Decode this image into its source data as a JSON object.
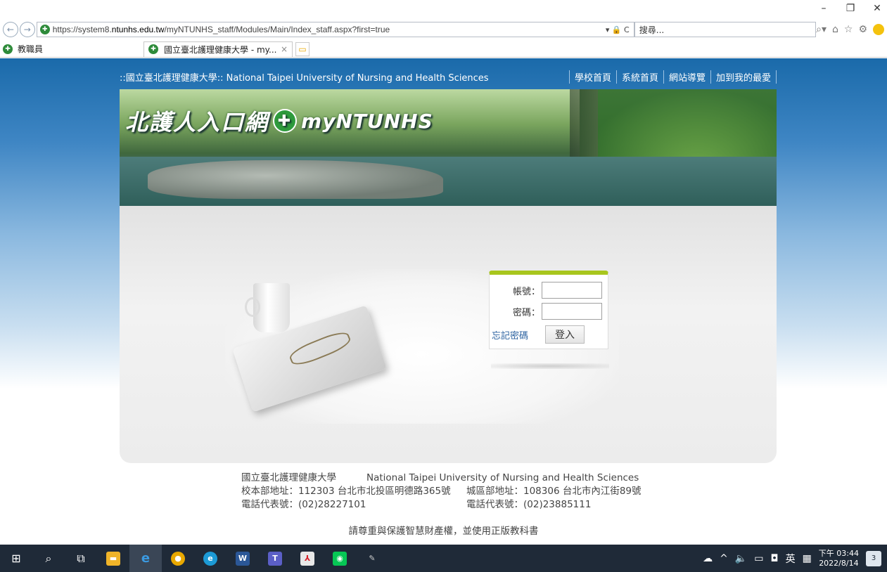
{
  "browser": {
    "url_prefix": "https://system8.",
    "url_domain": "ntunhs.edu.tw",
    "url_path": "/myNTUNHS_staff/Modules/Main/Index_staff.aspx?first=true",
    "addr_tools": "▾ 🔒 C",
    "search_placeholder": "搜尋...",
    "favorite_label": "教職員",
    "tab_title": "國立臺北護理健康大學 - my...",
    "tab_close": "×",
    "minimize": "–",
    "restore": "❐",
    "close": "✕"
  },
  "header": {
    "school_title": "::國立臺北護理健康大學:: National Taipei University of Nursing and Health Sciences",
    "links": [
      "學校首頁",
      "系統首頁",
      "網站導覽",
      "加到我的最愛"
    ]
  },
  "banner": {
    "title": "北護人入口網",
    "logo_text": "myNTUNHS"
  },
  "login": {
    "account_label": "帳號：",
    "password_label": "密碼：",
    "forgot_label": "忘記密碼",
    "submit_label": "登入"
  },
  "footer": {
    "name_zh": "國立臺北護理健康大學",
    "name_en": "National Taipei University of Nursing and Health Sciences",
    "addr_main": "校本部地址：112303 台北市北投區明德路365號",
    "addr_city": "城區部地址：108306 台北市內江街89號",
    "phone_main": "電話代表號：(02)28227101",
    "phone_city": "電話代表號：(02)23885111",
    "copyright": "請尊重與保護智慧財產權，並使用正版教科書"
  },
  "taskbar": {
    "ime": "英",
    "time": "下午 03:44",
    "date": "2022/8/14",
    "notifications": "3"
  }
}
